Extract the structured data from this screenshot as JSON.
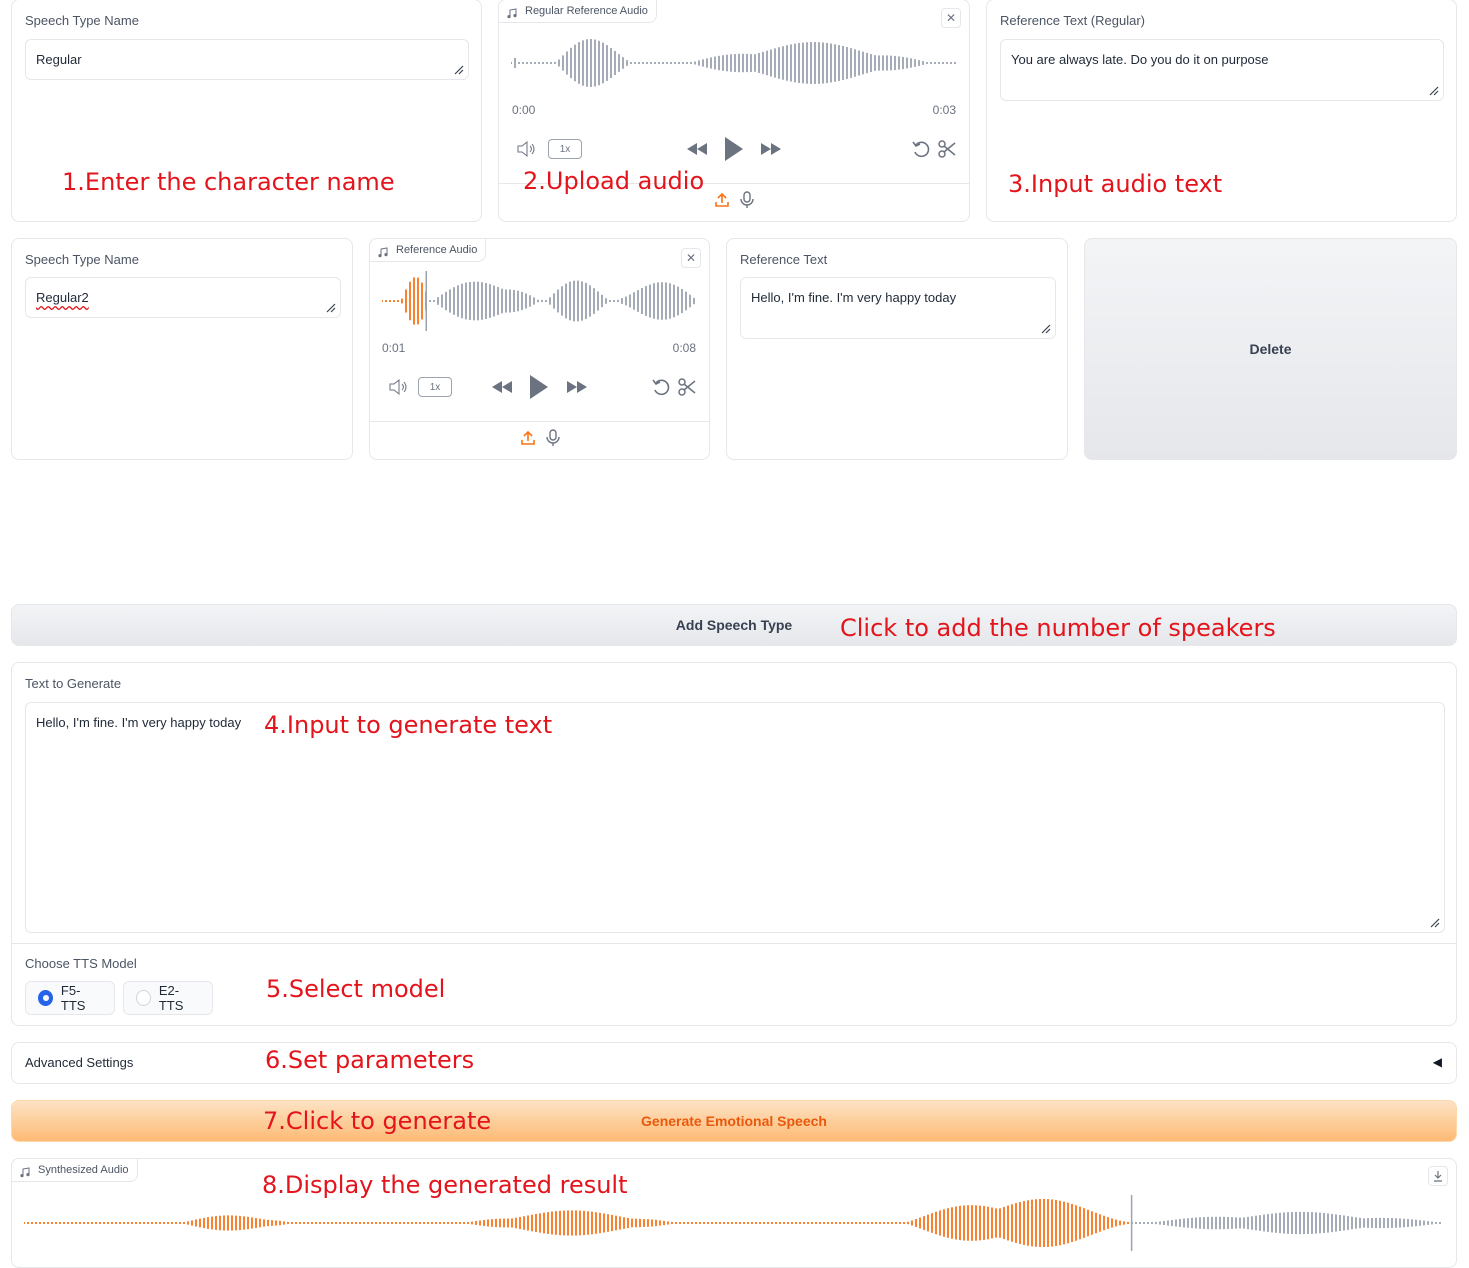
{
  "colors": {
    "accent": "#f97316",
    "annotation": "#e3141b",
    "radio_selected": "#2563eb"
  },
  "row1": {
    "name_label": "Speech Type Name",
    "name_value": "Regular",
    "audio_label": "Regular Reference Audio",
    "audio_time_start": "0:00",
    "audio_time_end": "0:03",
    "audio_speed": "1x",
    "text_label": "Reference Text (Regular)",
    "text_value": "You are always late. Do you do it on purpose"
  },
  "row2": {
    "name_label": "Speech Type Name",
    "name_value": "Regular2",
    "audio_label": "Reference Audio",
    "audio_time_start": "0:01",
    "audio_time_end": "0:08",
    "audio_speed": "1x",
    "text_label": "Reference Text",
    "text_value": "Hello, I'm fine. I'm very happy today",
    "delete_label": "Delete"
  },
  "add_button_label": "Add Speech Type",
  "generate": {
    "label": "Text to Generate",
    "value": "Hello, I'm fine. I'm very happy today"
  },
  "model": {
    "label": "Choose TTS Model",
    "options": [
      "F5-TTS",
      "E2-TTS"
    ],
    "selected": "F5-TTS"
  },
  "advanced": {
    "label": "Advanced Settings",
    "arrow": "◀"
  },
  "generate_button_label": "Generate Emotional Speech",
  "output": {
    "label": "Synthesized Audio"
  },
  "annotations": {
    "a1": "1.Enter the character name",
    "a2": "2.Upload audio",
    "a3": "3.Input audio text",
    "a_add": "Click to add the number of speakers",
    "a4": "4.Input to generate text",
    "a5": "5.Select model",
    "a6": "6.Set parameters",
    "a7": "7.Click to generate",
    "a8": "8.Display the generated result"
  }
}
